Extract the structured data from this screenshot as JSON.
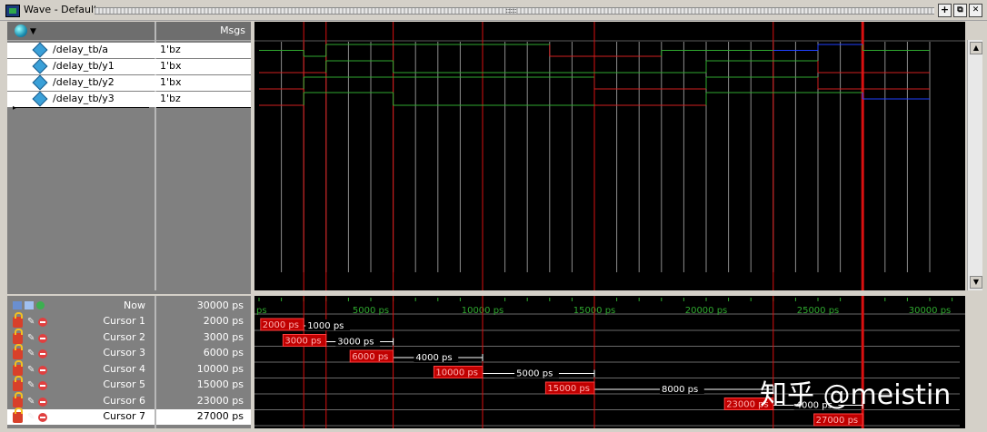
{
  "window": {
    "title": "Wave - Default",
    "controls": {
      "dock": "+",
      "undock": "⧉",
      "close": "✕"
    }
  },
  "header": {
    "msgs_label": "Msgs"
  },
  "signals": [
    {
      "name": "/delay_tb/a",
      "value": "1'bz"
    },
    {
      "name": "/delay_tb/y1",
      "value": "1'bx"
    },
    {
      "name": "/delay_tb/y2",
      "value": "1'bx"
    },
    {
      "name": "/delay_tb/y3",
      "value": "1'bz"
    }
  ],
  "now": {
    "label": "Now",
    "value": "30000 ps"
  },
  "cursors": [
    {
      "label": "Cursor 1",
      "value": "2000 ps",
      "time": 2000
    },
    {
      "label": "Cursor 2",
      "value": "3000 ps",
      "time": 3000
    },
    {
      "label": "Cursor 3",
      "value": "6000 ps",
      "time": 6000
    },
    {
      "label": "Cursor 4",
      "value": "10000 ps",
      "time": 10000
    },
    {
      "label": "Cursor 5",
      "value": "15000 ps",
      "time": 15000
    },
    {
      "label": "Cursor 6",
      "value": "23000 ps",
      "time": 23000
    },
    {
      "label": "Cursor 7",
      "value": "27000 ps",
      "time": 27000
    }
  ],
  "cursor_deltas": [
    {
      "label": "1000 ps",
      "from": 2000,
      "to": 3000
    },
    {
      "label": "3000 ps",
      "from": 3000,
      "to": 6000
    },
    {
      "label": "4000 ps",
      "from": 6000,
      "to": 10000
    },
    {
      "label": "5000 ps",
      "from": 10000,
      "to": 15000
    },
    {
      "label": "8000 ps",
      "from": 15000,
      "to": 23000
    },
    {
      "label": "4000 ps",
      "from": 23000,
      "to": 27000
    }
  ],
  "timeline": {
    "start_label": "ps",
    "ticks": [
      {
        "t": 5000,
        "label": "5000 ps"
      },
      {
        "t": 10000,
        "label": "10000 ps"
      },
      {
        "t": 15000,
        "label": "15000 ps"
      },
      {
        "t": 20000,
        "label": "20000 ps"
      },
      {
        "t": 25000,
        "label": "25000 ps"
      },
      {
        "t": 30000,
        "label": "30000 ps"
      }
    ]
  },
  "watermark": "知乎 @meistin",
  "colors": {
    "wave_green": "#2fa82f",
    "wave_red": "#d02020",
    "wave_blue": "#2040ff",
    "cursor_red": "#d81010",
    "grid_gray": "#8c8c8c",
    "cursor_label_bg": "#c00000"
  }
}
